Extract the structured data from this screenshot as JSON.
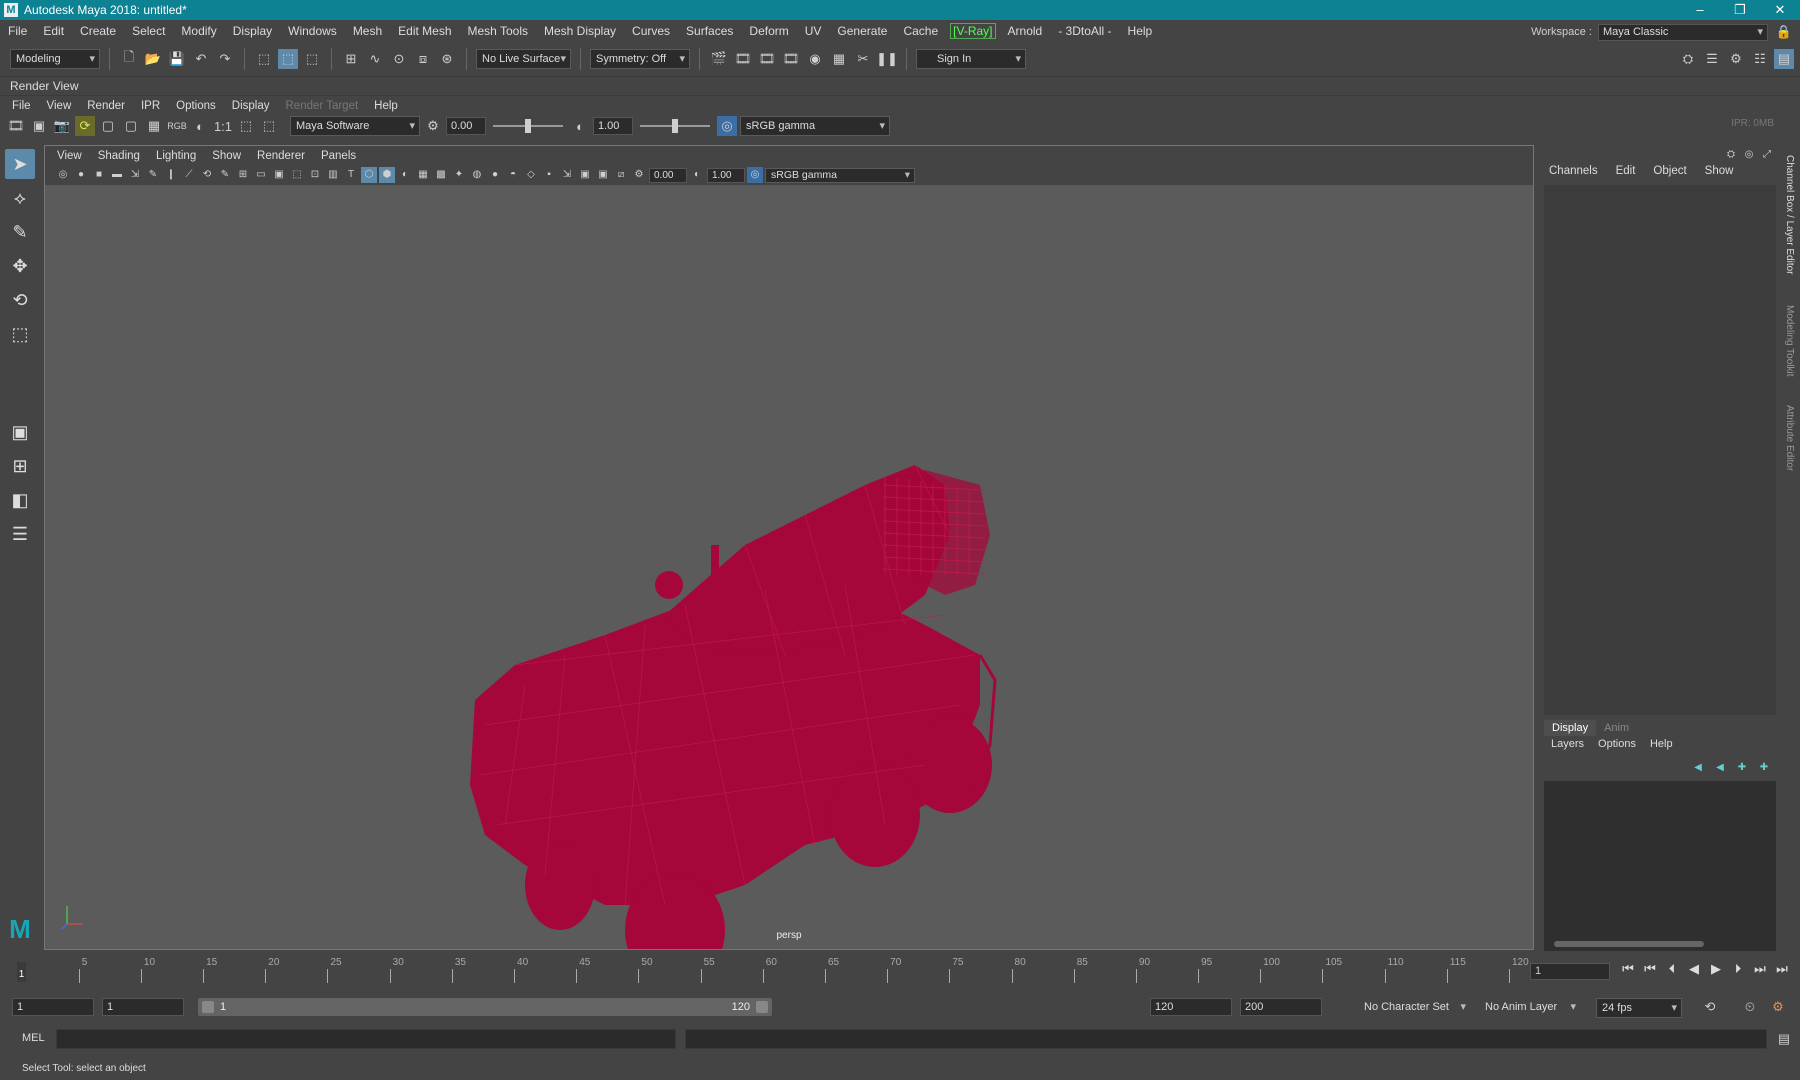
{
  "window": {
    "title": "Autodesk Maya 2018: untitled*",
    "logo_letter": "M"
  },
  "menubar": {
    "items": [
      "File",
      "Edit",
      "Create",
      "Select",
      "Modify",
      "Display",
      "Windows",
      "Mesh",
      "Edit Mesh",
      "Mesh Tools",
      "Mesh Display",
      "Curves",
      "Surfaces",
      "Deform",
      "UV",
      "Generate",
      "Cache",
      "[V-Ray]",
      "Arnold",
      "- 3DtoAll -",
      "Help"
    ],
    "workspace_label": "Workspace :",
    "workspace_value": "Maya Classic"
  },
  "statusline": {
    "menuset": "Modeling",
    "live_surface": "No Live Surface",
    "symmetry": "Symmetry: Off",
    "sign_in": "Sign In"
  },
  "render_view": {
    "title": "Render View",
    "menus": [
      "File",
      "View",
      "Render",
      "IPR",
      "Options",
      "Display",
      "Render Target",
      "Help"
    ],
    "disabled_menu": "Render Target",
    "renderer": "Maya Software",
    "ratio_label": "1:1",
    "rgb_label": "RGB",
    "exposure": "0.00",
    "gamma": "1.00",
    "color_space": "sRGB gamma",
    "ipr_status": "IPR: 0MB"
  },
  "viewport": {
    "menus": [
      "View",
      "Shading",
      "Lighting",
      "Show",
      "Renderer",
      "Panels"
    ],
    "exposure": "0.00",
    "gamma": "1.00",
    "color_space": "sRGB gamma",
    "camera_label": "persp",
    "wireframe_color": "#a5073a",
    "background_color": "#5b5b5b"
  },
  "channel_box": {
    "menus": [
      "Channels",
      "Edit",
      "Object",
      "Show"
    ],
    "layer_tabs": [
      "Display",
      "Anim"
    ],
    "layer_menus": [
      "Layers",
      "Options",
      "Help"
    ]
  },
  "side_tabs": [
    "Channel Box / Layer Editor",
    "Modeling Toolkit",
    "Attribute Editor"
  ],
  "timeline": {
    "ticks": [
      5,
      10,
      15,
      20,
      25,
      30,
      35,
      40,
      45,
      50,
      55,
      60,
      65,
      70,
      75,
      80,
      85,
      90,
      95,
      100,
      105,
      110,
      115,
      120
    ],
    "min": 1,
    "max": 120,
    "current_frame": "1",
    "current_frame_field": "1"
  },
  "range": {
    "start": "1",
    "playback_start": "1",
    "range_start_label": "1",
    "range_end_label": "120",
    "playback_end": "120",
    "end": "200",
    "character_set": "No Character Set",
    "anim_layer": "No Anim Layer",
    "fps": "24 fps"
  },
  "command_line": {
    "language": "MEL"
  },
  "help_line": {
    "text": "Select Tool: select an object"
  }
}
